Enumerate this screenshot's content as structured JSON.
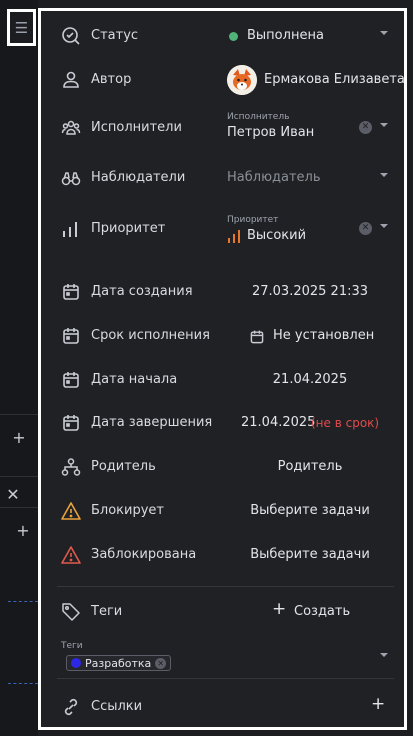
{
  "sidebar": {
    "menu_icon": "hamburger-icon",
    "plus_1": "+",
    "close": "✕",
    "plus_2": "+"
  },
  "fields": {
    "status": {
      "label": "Статус",
      "value": "Выполнена",
      "dot_color": "#4fb37a"
    },
    "author": {
      "label": "Автор",
      "value": "Ермакова Елизавета"
    },
    "assignees": {
      "label": "Исполнители",
      "field_label": "Исполнитель",
      "value": "Петров Иван"
    },
    "watchers": {
      "label": "Наблюдатели",
      "placeholder": "Наблюдатель"
    },
    "priority": {
      "label": "Приоритет",
      "field_label": "Приоритет",
      "value": "Высокий",
      "color": "#e8772e"
    },
    "created": {
      "label": "Дата создания",
      "value": "27.03.2025 21:33"
    },
    "deadline": {
      "label": "Срок исполнения",
      "value": "Не установлен"
    },
    "start": {
      "label": "Дата начала",
      "value": "21.04.2025"
    },
    "end": {
      "label": "Дата завершения",
      "value": "21.04.2025",
      "overdue": "(не в срок)"
    },
    "parent": {
      "label": "Родитель",
      "value": "Родитель"
    },
    "blocks": {
      "label": "Блокирует",
      "value": "Выберите задачи"
    },
    "blocked": {
      "label": "Заблокирована",
      "value": "Выберите задачи"
    },
    "tags": {
      "label": "Теги",
      "create": "Создать",
      "field_label": "Теги",
      "chips": [
        {
          "name": "Разработка",
          "color": "#2d28e6"
        }
      ]
    },
    "links": {
      "label": "Ссылки",
      "add": "+"
    }
  },
  "colors": {
    "accent_red": "#e04b4b",
    "warning_orange": "#e8a33c",
    "danger_red": "#e05a4b",
    "panel_bg": "#202125"
  }
}
